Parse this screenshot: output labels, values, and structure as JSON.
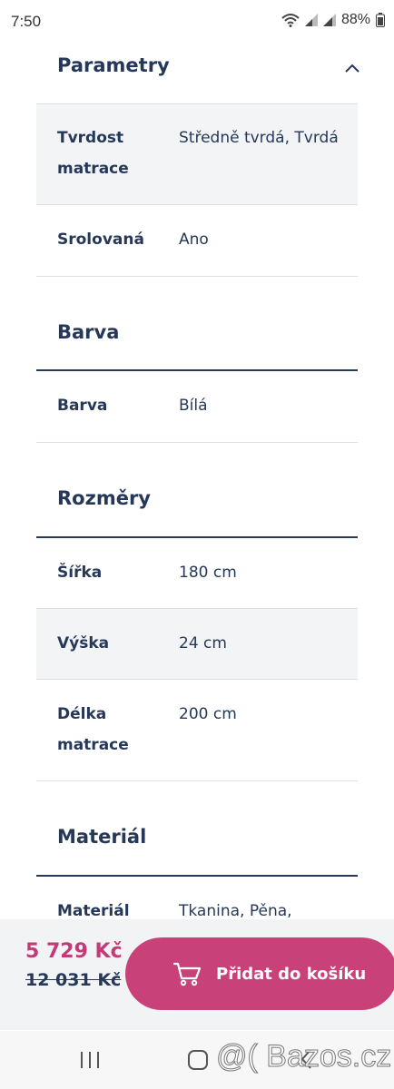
{
  "status_bar": {
    "time": "7:50",
    "battery": "88%"
  },
  "sections": {
    "parametry": {
      "title": "Parametry",
      "rows": [
        {
          "label_line1": "Tvrdost",
          "label_line2": "matrace",
          "value": "Středně tvrdá, Tvrdá"
        },
        {
          "label": "Srolovaná",
          "value": "Ano"
        }
      ]
    },
    "barva": {
      "title": "Barva",
      "rows": [
        {
          "label": "Barva",
          "value": "Bílá"
        }
      ]
    },
    "rozmery": {
      "title": "Rozměry",
      "rows": [
        {
          "label": "Šířka",
          "value": "180 cm"
        },
        {
          "label": "Výška",
          "value": "24 cm"
        },
        {
          "label_line1": "Délka",
          "label_line2": "matrace",
          "value": "200 cm"
        }
      ]
    },
    "material": {
      "title": "Materiál",
      "rows": [
        {
          "label": "Materiál",
          "value": "Tkanina, Pěna,"
        }
      ]
    }
  },
  "cart_bar": {
    "price": "5 729 Kč",
    "old_price": "12 031 Kč",
    "add_button_label": "Přidat do košíku"
  },
  "watermark": "@( Bazos.cz",
  "colors": {
    "accent": "#c94179",
    "text": "#26385a",
    "shaded_row": "#f3f4f6"
  }
}
